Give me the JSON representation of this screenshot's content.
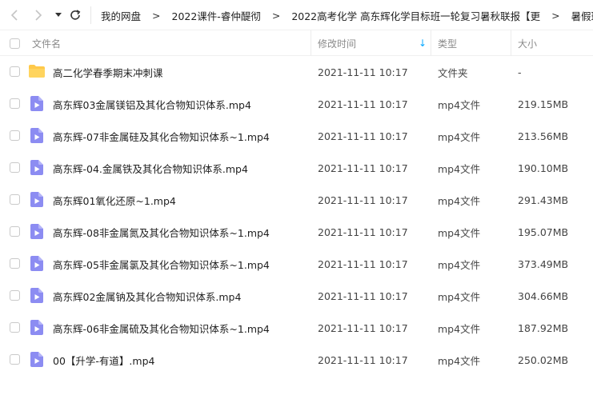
{
  "nav": {
    "breadcrumbs": [
      "我的网盘",
      "2022课件-睿仲醍彻",
      "2022高考化学 高东辉化学目标班一轮复习暑秋联报【更",
      "暑假班"
    ],
    "separator": ">"
  },
  "table": {
    "columns": {
      "name": "文件名",
      "modified": "修改时间",
      "type": "类型",
      "size": "大小"
    },
    "sort_indicator": "↓",
    "rows": [
      {
        "icon": "folder-icon",
        "name": "高二化学春季期末冲刺课",
        "modified": "2021-11-11 10:17",
        "type": "文件夹",
        "size": "-"
      },
      {
        "icon": "video-file-icon",
        "name": "高东辉03金属镁铝及其化合物知识体系.mp4",
        "modified": "2021-11-11 10:17",
        "type": "mp4文件",
        "size": "219.15MB"
      },
      {
        "icon": "video-file-icon",
        "name": "高东辉-07非金属硅及其化合物知识体系~1.mp4",
        "modified": "2021-11-11 10:17",
        "type": "mp4文件",
        "size": "213.56MB"
      },
      {
        "icon": "video-file-icon",
        "name": "高东辉-04.金属铁及其化合物知识体系.mp4",
        "modified": "2021-11-11 10:17",
        "type": "mp4文件",
        "size": "190.10MB"
      },
      {
        "icon": "video-file-icon",
        "name": "高东辉01氧化还原~1.mp4",
        "modified": "2021-11-11 10:17",
        "type": "mp4文件",
        "size": "291.43MB"
      },
      {
        "icon": "video-file-icon",
        "name": "高东辉-08非金属氮及其化合物知识体系~1.mp4",
        "modified": "2021-11-11 10:17",
        "type": "mp4文件",
        "size": "195.07MB"
      },
      {
        "icon": "video-file-icon",
        "name": "高东辉-05非金属氯及其化合物知识体系~1.mp4",
        "modified": "2021-11-11 10:17",
        "type": "mp4文件",
        "size": "373.49MB"
      },
      {
        "icon": "video-file-icon",
        "name": "高东辉02金属钠及其化合物知识体系.mp4",
        "modified": "2021-11-11 10:17",
        "type": "mp4文件",
        "size": "304.66MB"
      },
      {
        "icon": "video-file-icon",
        "name": "高东辉-06非金属硫及其化合物知识体系~1.mp4",
        "modified": "2021-11-11 10:17",
        "type": "mp4文件",
        "size": "187.92MB"
      },
      {
        "icon": "video-file-icon",
        "name": "00【升学-有道】.mp4",
        "modified": "2021-11-11 10:17",
        "type": "mp4文件",
        "size": "250.02MB"
      }
    ]
  },
  "colors": {
    "folder": "#ffc94a",
    "video": "#8c8cf2",
    "accent": "#06a7ff"
  }
}
